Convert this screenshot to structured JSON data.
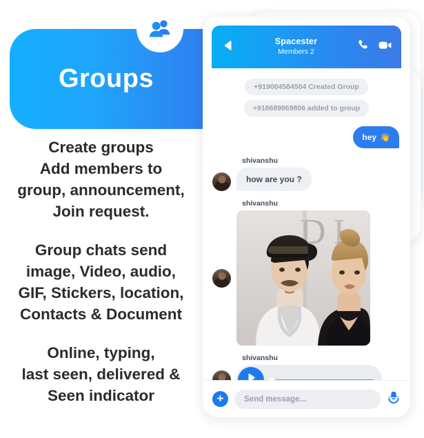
{
  "promo": {
    "banner_title": "Groups",
    "badge_icon": "group-people-icon",
    "paragraphs": [
      "Create groups\nAdd members to\ngroup, announcement,\nJoin request.",
      "Group chats send\nimage, Video, audio,\nGIF, Stickers, location,\nContacts & Document",
      "Online, typing,\nlast seen, delivered &\nSeen indicator"
    ]
  },
  "colors": {
    "accent_light": "#14AFFC",
    "accent_dark": "#3377EC",
    "header_left": "#06AEF5",
    "header_right": "#3A7BE8",
    "outgoing_bubble": "#2B7DF0",
    "incoming_bubble": "#EEF0F3",
    "system_pill_bg": "#EEF0F3",
    "system_pill_text": "#9AA1AD",
    "play_button": "#1D7AF0",
    "text_dark": "#2B2B2B"
  },
  "chat": {
    "header": {
      "back_icon": "back-arrow-icon",
      "title": "Spacester",
      "subtitle": "Members 2",
      "call_icon": "phone-icon",
      "video_icon": "video-camera-icon"
    },
    "system_messages": [
      "+919004584504 Created Group",
      "+918689869806 added to group"
    ],
    "messages": [
      {
        "type": "text-outgoing",
        "text": "hey",
        "emoji": "👋"
      },
      {
        "type": "text-incoming",
        "sender": "shivanshu",
        "text": "how are you ?"
      },
      {
        "type": "image-incoming",
        "sender": "shivanshu",
        "alt": "photo-of-two-people-on-red-carpet"
      },
      {
        "type": "audio-incoming",
        "sender": "shivanshu",
        "play_icon": "play-icon",
        "progress": 0
      }
    ],
    "composer": {
      "attach_icon": "plus-icon",
      "input_value": "",
      "input_placeholder": "Send message...",
      "mic_icon": "microphone-icon"
    }
  }
}
